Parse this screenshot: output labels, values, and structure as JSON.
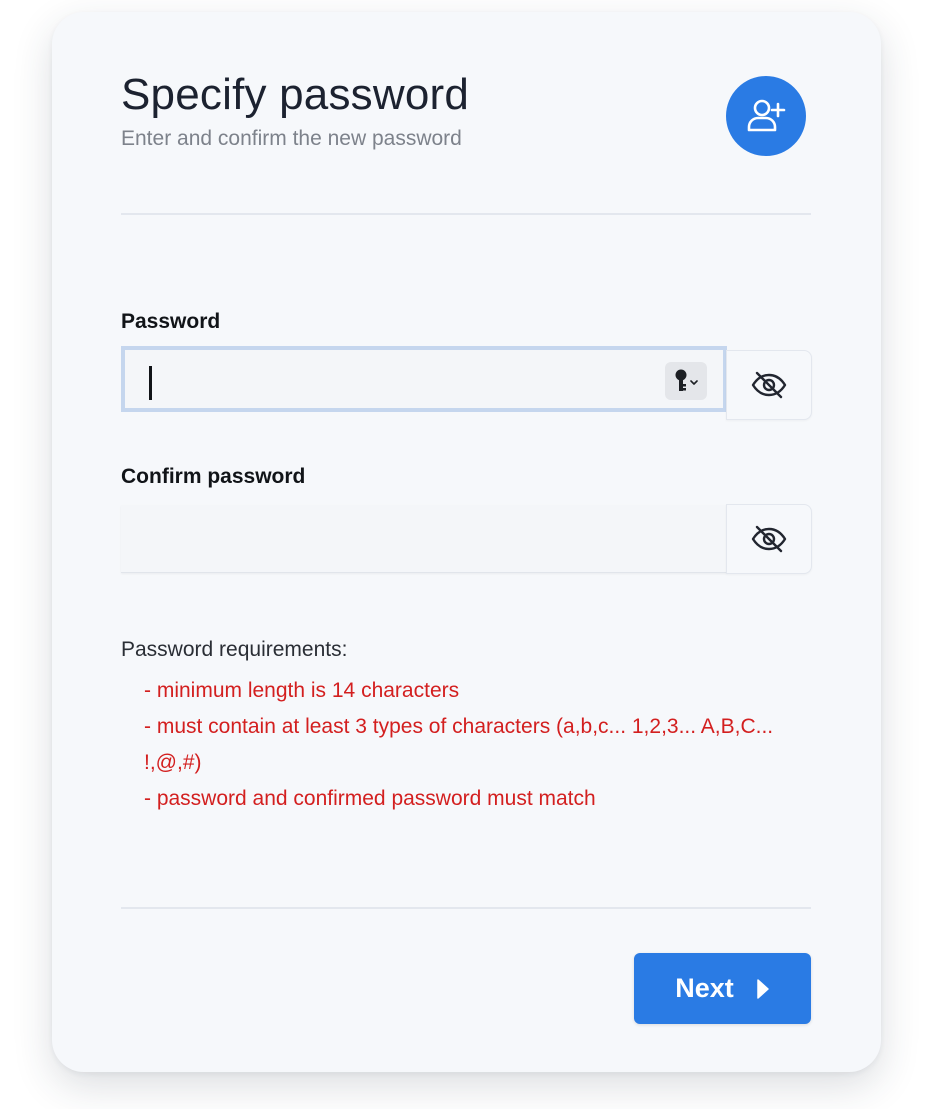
{
  "header": {
    "title": "Specify password",
    "subtitle": "Enter and confirm the new password",
    "avatar_icon": "add-user-icon"
  },
  "password_field": {
    "label": "Password",
    "value": "",
    "key_icon": "key-icon",
    "toggle_icon": "eye-slash-icon"
  },
  "confirm_field": {
    "label": "Confirm password",
    "value": "",
    "toggle_icon": "eye-slash-icon"
  },
  "requirements": {
    "heading": "Password requirements:",
    "items": [
      "- minimum length is 14 characters",
      "- must contain at least 3 types of characters (a,b,c... 1,2,3... A,B,C... !,@,#)",
      "- password and confirmed password must match"
    ]
  },
  "footer": {
    "next_label": "Next",
    "next_icon": "play-arrow-icon"
  },
  "colors": {
    "accent": "#2a7be4",
    "error": "#d31f1f",
    "card_background": "#f6f8fb",
    "focus_ring": "#c5d6ee"
  }
}
